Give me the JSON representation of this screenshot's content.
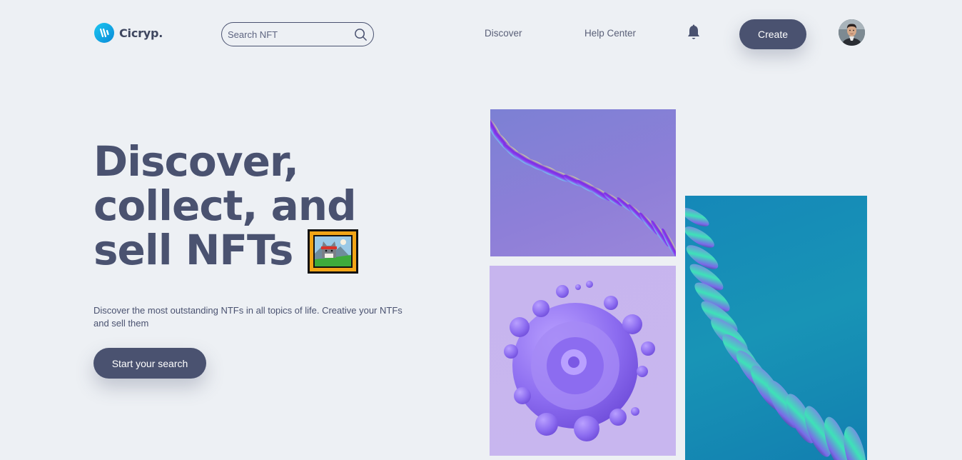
{
  "header": {
    "logo_text": "Cicryp.",
    "search": {
      "placeholder": "Search NFT",
      "value": ""
    },
    "nav": [
      {
        "label": "Discover"
      },
      {
        "label": "Help Center"
      }
    ],
    "create_label": "Create"
  },
  "hero": {
    "title_lines": [
      "Discover,",
      "collect, and",
      "sell NFTs"
    ],
    "subtitle": "Discover the most outstanding NTFs in all topics of life. Creative your NTFs and sell them",
    "cta_label": "Start your search"
  },
  "icons": {
    "logo": "logo-mark-icon",
    "search": "search-icon",
    "bell": "bell-icon",
    "frame": "framed-picture-icon"
  },
  "colors": {
    "background": "#edf0f4",
    "primary": "#4a5270",
    "logo_accent": "#0a8ad8"
  }
}
